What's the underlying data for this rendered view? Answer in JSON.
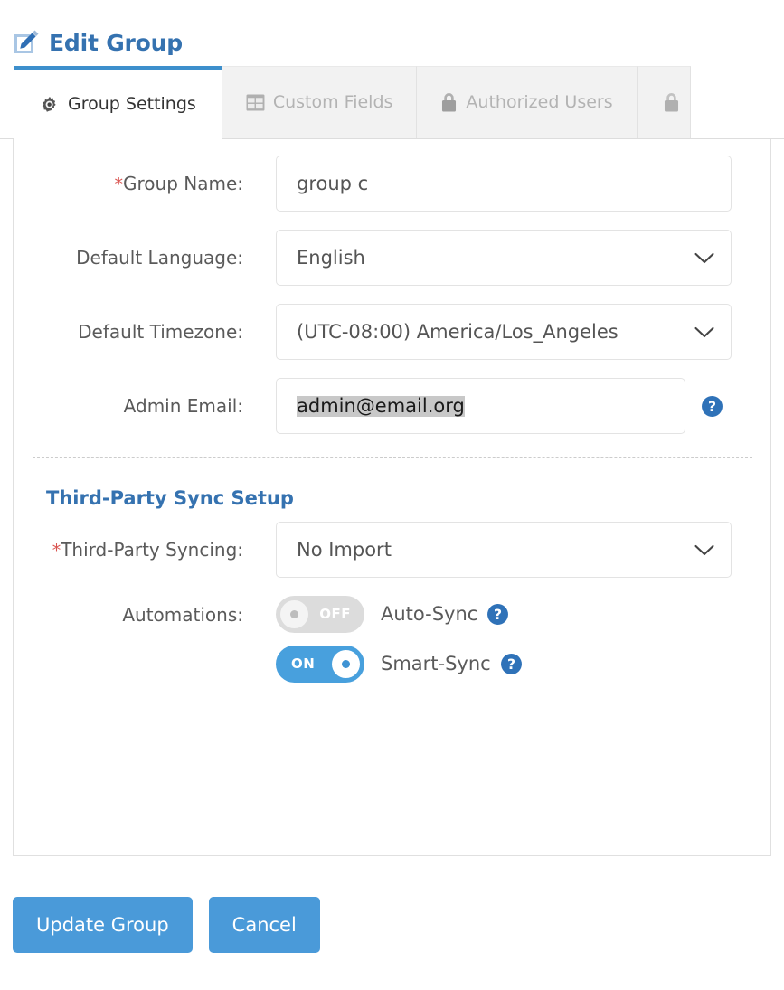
{
  "header": {
    "title": "Edit Group",
    "icon": "edit-pencil-icon"
  },
  "tabs": [
    {
      "label": "Group Settings",
      "icon": "gear-icon",
      "active": true
    },
    {
      "label": "Custom Fields",
      "icon": "grid-icon",
      "active": false
    },
    {
      "label": "Authorized Users",
      "icon": "lock-icon",
      "active": false
    },
    {
      "label": "",
      "icon": "lock-icon",
      "active": false
    }
  ],
  "form": {
    "group_name": {
      "label": "Group Name:",
      "required": true,
      "value": "group c"
    },
    "default_language": {
      "label": "Default Language:",
      "required": false,
      "value": "English"
    },
    "default_timezone": {
      "label": "Default Timezone:",
      "required": false,
      "value": "(UTC-08:00) America/Los_Angeles"
    },
    "admin_email": {
      "label": "Admin Email:",
      "required": false,
      "value": "admin@email.org",
      "selected": true,
      "help_icon": "help-circle-icon"
    }
  },
  "sync_section": {
    "title": "Third-Party Sync Setup",
    "third_party_syncing": {
      "label": "Third-Party Syncing:",
      "required": true,
      "value": "No Import"
    },
    "automations": {
      "label": "Automations:",
      "toggles": [
        {
          "state_label": "OFF",
          "state": "off",
          "caption": "Auto-Sync",
          "help_icon": "help-circle-icon"
        },
        {
          "state_label": "ON",
          "state": "on",
          "caption": "Smart-Sync",
          "help_icon": "help-circle-icon"
        }
      ]
    }
  },
  "footer": {
    "primary_button": "Update Group",
    "secondary_button": "Cancel"
  },
  "colors": {
    "accent_blue": "#3d8fcc",
    "title_blue": "#3572b0",
    "button_blue": "#4a9ad9",
    "toggle_on": "#48a0dd",
    "toggle_off": "#dcdcdc",
    "required_red": "#d9534f",
    "selection_gray": "#c8c8c8"
  }
}
